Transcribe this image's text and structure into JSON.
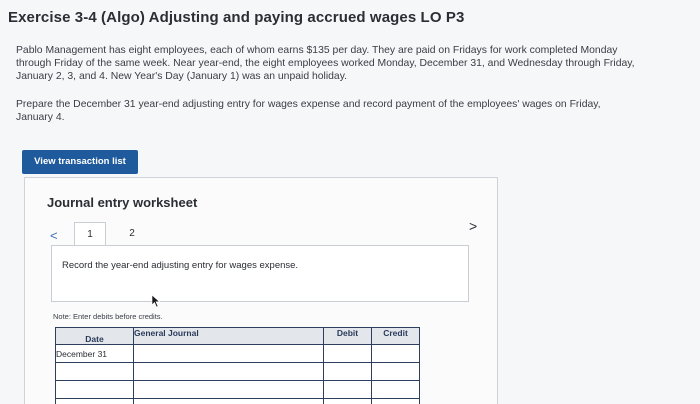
{
  "exercise": {
    "title": "Exercise 3-4 (Algo) Adjusting and paying accrued wages LO P3",
    "paragraph1_line1": "Pablo Management has eight employees, each of whom earns $135 per day. They are paid on Fridays for work completed Monday",
    "paragraph1_line2": "through Friday of the same week. Near year-end, the eight employees worked Monday, December 31, and Wednesday through Friday,",
    "paragraph1_line3": "January 2, 3, and 4. New Year's Day (January 1) was an unpaid holiday.",
    "paragraph2_line1": "Prepare the December 31 year-end adjusting entry for wages expense and record payment of the employees' wages on Friday,",
    "paragraph2_line2": "January 4."
  },
  "toolbar": {
    "view_transaction_list_label": "View transaction list"
  },
  "worksheet": {
    "title": "Journal entry worksheet",
    "prev_glyph": "<",
    "next_glyph": ">",
    "tabs": [
      {
        "label": "1",
        "active": true
      },
      {
        "label": "2",
        "active": false
      }
    ],
    "instruction": "Record the year-end adjusting entry for wages expense.",
    "note": "Note: Enter debits before credits."
  },
  "journal_table": {
    "headers": {
      "date": "Date",
      "general_journal": "General Journal",
      "debit": "Debit",
      "credit": "Credit"
    },
    "rows": [
      {
        "date": "December 31",
        "account": "",
        "debit": "",
        "credit": ""
      },
      {
        "date": "",
        "account": "",
        "debit": "",
        "credit": ""
      },
      {
        "date": "",
        "account": "",
        "debit": "",
        "credit": ""
      },
      {
        "date": "",
        "account": "",
        "debit": "",
        "credit": ""
      }
    ]
  },
  "colors": {
    "button_blue": "#1f5a9d",
    "table_border": "#2d3f5f",
    "header_bg": "#e3e6ea"
  }
}
